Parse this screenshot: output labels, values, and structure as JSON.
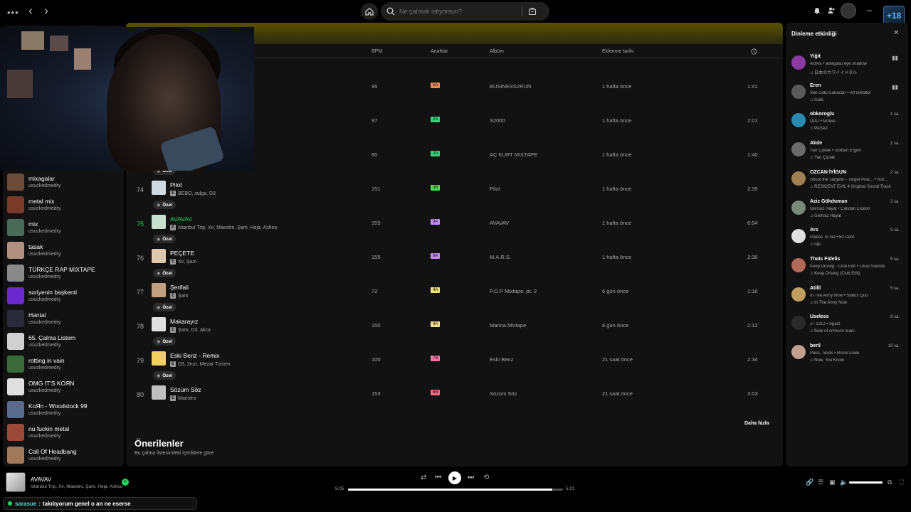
{
  "search": {
    "placeholder": "Ne çalmak istiyorsun?"
  },
  "columns": {
    "bpm": "BPM",
    "key": "Anahtar",
    "album": "Albüm",
    "added": "Eklenme tarihi"
  },
  "badge_label": "Özel",
  "tracks": [
    {
      "num": "",
      "title": "",
      "artists": "",
      "bpm": "95",
      "key": "5A",
      "key_color": "#f08a5d",
      "album": "BUSINESS2RUN",
      "added": "1 hafta önce",
      "duration": "1:41"
    },
    {
      "num": "",
      "title": "",
      "artists": "",
      "bpm": "97",
      "key": "2A",
      "key_color": "#38d17a",
      "album": "S2000",
      "added": "1 hafta önce",
      "duration": "2:01"
    },
    {
      "num": "",
      "title": "",
      "artists": "",
      "bpm": "80",
      "key": "2A",
      "key_color": "#38d17a",
      "album": "AÇ KURT MIXTAPE",
      "added": "1 hafta önce",
      "duration": "1:40"
    },
    {
      "num": "74",
      "title": "Pilot",
      "artists": "BEBO, sulga, D3",
      "bpm": "151",
      "key": "3B",
      "key_color": "#4ee04e",
      "album": "Pilot",
      "added": "1 hafta önce",
      "duration": "2:39"
    },
    {
      "num": "75",
      "title": "AVAVAV",
      "artists": "Istanbul Trip, Xir, Maestro, Şam, Heja, Ashoo",
      "bpm": "155",
      "key": "9A",
      "key_color": "#c38df0",
      "album": "AVAVAV",
      "added": "1 hafta önce",
      "duration": "6:04",
      "active": true
    },
    {
      "num": "76",
      "title": "PEÇETE",
      "artists": "Xir, Şam",
      "bpm": "155",
      "key": "9A",
      "key_color": "#c38df0",
      "album": "M.A.R.S.",
      "added": "1 hafta önce",
      "duration": "2:30"
    },
    {
      "num": "77",
      "title": "Şerifali",
      "artists": "Şam",
      "bpm": "72",
      "key": "4A",
      "key_color": "#f0e08a",
      "album": "P.O.P Mixtape, pt. 2",
      "added": "6 gün önce",
      "duration": "1:16"
    },
    {
      "num": "78",
      "title": "Makarayız",
      "artists": "Şam, D3, akca",
      "bpm": "150",
      "key": "4A",
      "key_color": "#f0e08a",
      "album": "Marina Mixtape",
      "added": "6 gün önce",
      "duration": "2:12"
    },
    {
      "num": "79",
      "title": "Eski Benz - Remix",
      "artists": "D3, 2run, Mezar Turizm",
      "bpm": "100",
      "key": "7B",
      "key_color": "#f07aa8",
      "album": "Eski Benz",
      "added": "21 saat önce",
      "duration": "2:34"
    },
    {
      "num": "80",
      "title": "Sözüm Söz",
      "artists": "Maestro",
      "bpm": "153",
      "key": "6B",
      "key_color": "#f06a80",
      "album": "Sözüm Söz",
      "added": "21 saat önce",
      "duration": "3:03"
    }
  ],
  "more_label": "Daha fazla",
  "recommended": {
    "title": "Önerilenler",
    "subtitle": "Bu çalma listesindeki içeriklere göre"
  },
  "playlists": [
    {
      "name": "mixagalar",
      "owner": "usuckedmedry",
      "color": "#6b4b3a",
      "collab": true
    },
    {
      "name": "metal mix",
      "owner": "usuckedmedry",
      "color": "#7a3a2a",
      "collab": true
    },
    {
      "name": "mix",
      "owner": "usuckedmedry",
      "color": "#4a6a5a",
      "collab": true
    },
    {
      "name": "tasak",
      "owner": "usuckedmedry",
      "color": "#b09080",
      "collab": false
    },
    {
      "name": "TÜRKÇE RAP MIXTAPE",
      "owner": "usuckedmedry",
      "color": "#8a8a8a",
      "collab": false
    },
    {
      "name": "suriyenin başkenti",
      "owner": "usuckedmedry",
      "color": "#6a2ad0",
      "collab": false
    },
    {
      "name": "Hantal",
      "owner": "usuckedmedry",
      "color": "#2a2a3a",
      "collab": false
    },
    {
      "name": "65. Çalma Listem",
      "owner": "usuckedmedry",
      "color": "#d0d0d0",
      "collab": false
    },
    {
      "name": "rotting in vain",
      "owner": "usuckedmedry",
      "color": "#3a6a3a",
      "collab": false
    },
    {
      "name": "OMG IT'S KOЯN",
      "owner": "usuckedmedry",
      "color": "#e0e0e0",
      "collab": false
    },
    {
      "name": "KoЯn - Woodstock 99",
      "owner": "usuckedmedry",
      "color": "#5a6a8a",
      "collab": false
    },
    {
      "name": "nu fuckin metal",
      "owner": "usuckedmedry",
      "color": "#9a4a3a",
      "collab": false
    },
    {
      "name": "Call Of Headbang",
      "owner": "usuckedmedry",
      "color": "#a07a5a",
      "collab": false
    }
  ],
  "friend_activity": {
    "title": "Dinleme etkinliği",
    "friends": [
      {
        "name": "Yiğit",
        "track": "Aches • aisagasu eye shadow",
        "context": "日本のカワイイメタル",
        "time": "",
        "playing": true,
        "color": "#8a3aa0"
      },
      {
        "name": "Eren",
        "track": "Van Gölü Canavarı • Art Diktatör",
        "context": "Isola",
        "time": "",
        "playing": true,
        "color": "#5a5a5a"
      },
      {
        "name": "obkoroglu",
        "track": "DVD • Motive",
        "context": "PASAJ",
        "time": "1 sa.",
        "playing": false,
        "color": "#2a8ab0"
      },
      {
        "name": "Akde",
        "track": "Yarı Çıplak • Gülben Ergen",
        "context": "Yarı Çıplak",
        "time": "1 sa.",
        "playing": false,
        "color": "#6a6a6a"
      },
      {
        "name": "OZCAN İYİGUN",
        "track": "Shoot the Targets! - Target Prac... • Kota Suz...",
        "context": "RESIDENT EVIL 4 Original Sound Track",
        "time": "2 sa.",
        "playing": false,
        "color": "#a08050"
      },
      {
        "name": "Aziz Gökduman",
        "track": "Gemsiz Hayat • Candan Erçetin",
        "context": "Gemsiz Hayat",
        "time": "2 sa.",
        "playing": false,
        "color": "#7a8a7a"
      },
      {
        "name": "Ars",
        "track": "Places To Go • 50 Cent",
        "context": "rap",
        "time": "5 sa.",
        "playing": false,
        "color": "#e0e0e0"
      },
      {
        "name": "Thais Fidelis",
        "track": "Keep Driving - Club Edit • Local Suicide",
        "context": "Keep Driving (Club Edit)",
        "time": "5 sa.",
        "playing": false,
        "color": "#b06a5a"
      },
      {
        "name": "Atilll",
        "track": "In The Army Now • Status Quo",
        "context": "In The Army Now",
        "time": "5 sa.",
        "playing": false,
        "color": "#c0a060"
      },
      {
        "name": "Useless",
        "track": "JT 1212 • Sgarz",
        "context": "flask of crimson tears",
        "time": "8 sa.",
        "playing": false,
        "color": "#2a2a2a"
      },
      {
        "name": "beril",
        "track": "Paris, Texas • Rosie Lowe",
        "context": "Now, You Know",
        "time": "19 sa.",
        "playing": false,
        "color": "#c0a090"
      }
    ]
  },
  "now_playing": {
    "title": "AVAVAV",
    "artists": "Istanbul Trip, Xir, Maestro, Şam, Heja, Ashoo",
    "elapsed": "5:05",
    "total": "5:21",
    "progress": 0.95,
    "volume": 1.0
  },
  "chat": {
    "user": "sarasue",
    "separator": ":",
    "message": "takılıyorum genel o an ne eserse"
  },
  "overlay_badge": "+18"
}
